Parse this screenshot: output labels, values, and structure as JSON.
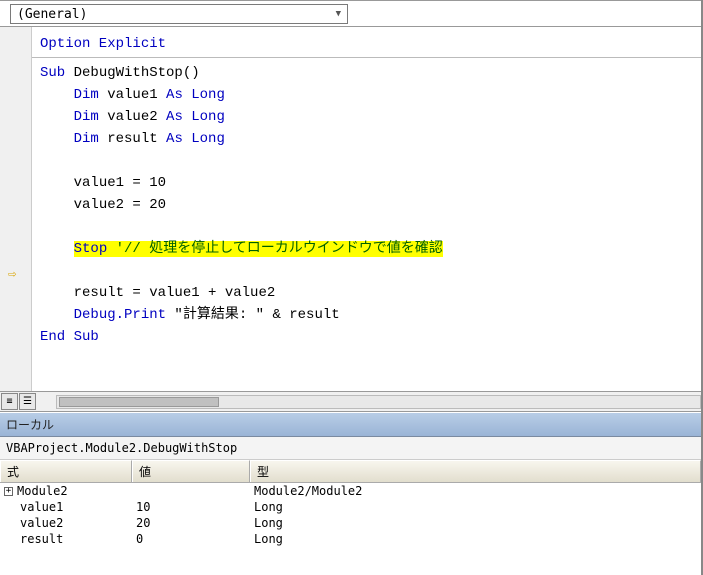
{
  "dropdown": {
    "label": "(General)"
  },
  "code": {
    "option_kw": "Option Explicit",
    "sub_kw": "Sub",
    "sub_name": " DebugWithStop()",
    "dim_kw": "Dim",
    "as_long": "As Long",
    "var1": " value1 ",
    "var2": " value2 ",
    "var3": " result ",
    "assign1": "value1 = 10",
    "assign2": "value2 = 20",
    "stop_kw": "Stop",
    "stop_comment": " '// 処理を停止してローカルウインドウで値を確認",
    "calc": "result = value1 + value2",
    "debug_print_kw": "Debug.Print",
    "debug_print_rest": " \"計算結果: \" & result",
    "end_sub": "End Sub"
  },
  "locals": {
    "title": "ローカル",
    "context": "VBAProject.Module2.DebugWithStop",
    "headers": {
      "expr": "式",
      "value": "値",
      "type": "型"
    },
    "rows": [
      {
        "expandable": true,
        "name": "Module2",
        "value": "",
        "type": "Module2/Module2"
      },
      {
        "indent": true,
        "name": "value1",
        "value": "10",
        "type": "Long"
      },
      {
        "indent": true,
        "name": "value2",
        "value": "20",
        "type": "Long"
      },
      {
        "indent": true,
        "name": "result",
        "value": "0",
        "type": "Long"
      }
    ]
  },
  "arrow_glyph": "⇨"
}
